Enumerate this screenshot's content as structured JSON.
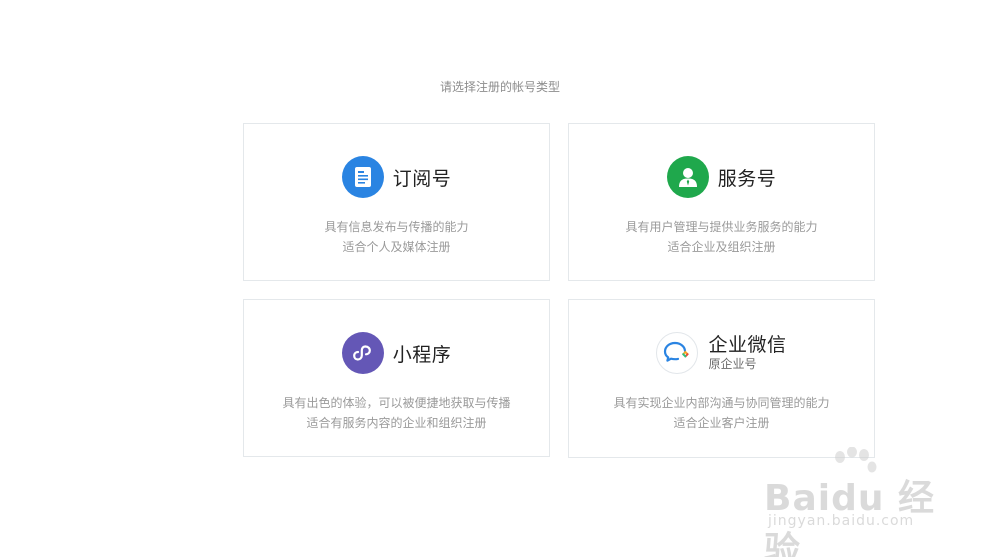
{
  "prompt": "请选择注册的帐号类型",
  "cards": [
    {
      "title": "订阅号",
      "icon": "document-icon",
      "icon_color": "#2a84e2",
      "lines": [
        "具有信息发布与传播的能力",
        "适合个人及媒体注册"
      ]
    },
    {
      "title": "服务号",
      "icon": "user-icon",
      "icon_color": "#1fa84c",
      "lines": [
        "具有用户管理与提供业务服务的能力",
        "适合企业及组织注册"
      ]
    },
    {
      "title": "小程序",
      "icon": "mini-program-icon",
      "icon_color": "#6457b6",
      "lines": [
        "具有出色的体验，可以被便捷地获取与传播",
        "适合有服务内容的企业和组织注册"
      ]
    },
    {
      "title": "企业微信",
      "subtitle": "原企业号",
      "icon": "wechat-work-icon",
      "icon_color": "#2a84e2",
      "lines": [
        "具有实现企业内部沟通与协同管理的能力",
        "适合企业客户注册"
      ]
    }
  ],
  "watermark": {
    "main": "Baidu 经验",
    "sub": "jingyan.baidu.com"
  }
}
